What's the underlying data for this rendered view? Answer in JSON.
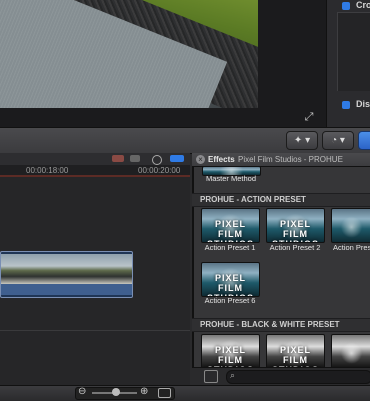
{
  "viewer": {
    "fullscreen_icon": "expand-arrows-icon"
  },
  "inspector": {
    "item1_label": "Cro",
    "item2_label": "Dist",
    "accent_color": "#2f7be6"
  },
  "toolbar": {
    "enhance_icon": "magic-wand-icon",
    "retime_icon": "speedometer-icon",
    "dropdown_glyph": "▾"
  },
  "timeline": {
    "timecodes": [
      "00:00:18:00",
      "00:00:20:00"
    ],
    "clip_color": "#3f5f8f"
  },
  "effects": {
    "title": "Effects",
    "subtitle": "Pixel Film Studios - PROHUE",
    "top_item": "Master Method",
    "sections": [
      {
        "name": "PROHUE - ACTION PRESET",
        "items": [
          "Action Preset 1",
          "Action Preset 2",
          "Action Prese",
          "Action Preset 6"
        ]
      },
      {
        "name": "PROHUE - BLACK & WHITE PRESET",
        "items": []
      }
    ],
    "thumb_text": "PIXEL FILM STUDIOS"
  },
  "bottom": {
    "zoom_out_icon": "zoom-out-icon",
    "zoom_in_icon": "zoom-in-icon"
  }
}
